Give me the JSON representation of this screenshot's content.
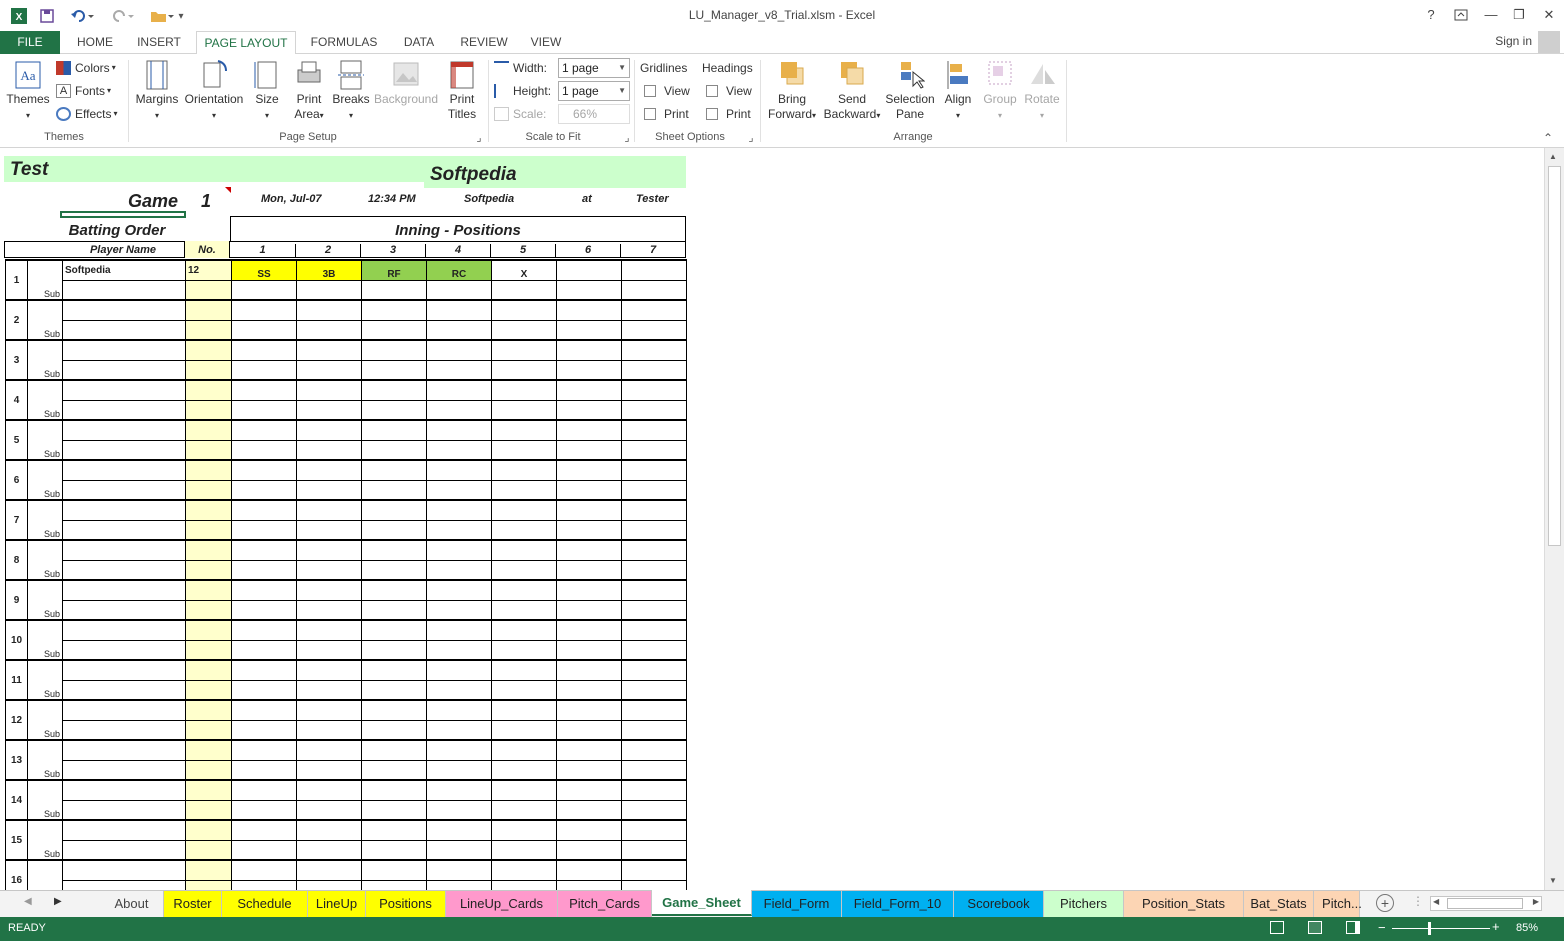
{
  "window": {
    "title": "LU_Manager_v8_Trial.xlsm - Excel",
    "sign_in": "Sign in",
    "help": "?",
    "controls": {
      "minimize": "—",
      "restore": "❐",
      "close": "✕"
    }
  },
  "ribbon_tabs": [
    {
      "label": "FILE"
    },
    {
      "label": "HOME"
    },
    {
      "label": "INSERT"
    },
    {
      "label": "PAGE LAYOUT"
    },
    {
      "label": "FORMULAS"
    },
    {
      "label": "DATA"
    },
    {
      "label": "REVIEW"
    },
    {
      "label": "VIEW"
    }
  ],
  "ribbon": {
    "themes": {
      "themes": "Themes",
      "colors": "Colors",
      "fonts": "Fonts",
      "effects": "Effects",
      "group": "Themes"
    },
    "page_setup": {
      "margins": "Margins",
      "orientation": "Orientation",
      "size": "Size",
      "print_area_1": "Print",
      "print_area_2": "Area",
      "breaks": "Breaks",
      "background": "Background",
      "print_titles_1": "Print",
      "print_titles_2": "Titles",
      "group": "Page Setup"
    },
    "scale": {
      "width_label": "Width:",
      "width_value": "1 page",
      "height_label": "Height:",
      "height_value": "1 page",
      "scale_label": "Scale:",
      "scale_value": "66%",
      "group": "Scale to Fit"
    },
    "sheet_options": {
      "gridlines": "Gridlines",
      "headings": "Headings",
      "view": "View",
      "print": "Print",
      "group": "Sheet Options"
    },
    "arrange": {
      "bring_1": "Bring",
      "bring_2": "Forward",
      "send_1": "Send",
      "send_2": "Backward",
      "selection_1": "Selection",
      "selection_2": "Pane",
      "align": "Align",
      "group_btn": "Group",
      "rotate": "Rotate",
      "group": "Arrange"
    }
  },
  "sheet": {
    "title": "Test",
    "brand": "Softpedia",
    "game_label": "Game",
    "game_number": "1",
    "date": "Mon,  Jul-07",
    "time": "12:34 PM",
    "opponent": "Softpedia",
    "at": "at",
    "location": "Tester",
    "batting_order": "Batting Order",
    "innings_title": "Inning - Positions",
    "col_player": "Player Name",
    "col_no": "No.",
    "innings": [
      "1",
      "2",
      "3",
      "4",
      "5",
      "6",
      "7"
    ],
    "sub_label": "Sub",
    "first_player": {
      "name": "Softpedia",
      "no": "12",
      "positions": [
        "SS",
        "3B",
        "RF",
        "RC",
        "X",
        "",
        ""
      ]
    },
    "order_numbers": [
      "1",
      "2",
      "3",
      "4",
      "5",
      "6",
      "7",
      "8",
      "9",
      "10",
      "11",
      "12",
      "13",
      "14",
      "15",
      "16"
    ]
  },
  "sheet_tabs": [
    {
      "label": "About",
      "color": "#f3f3f3"
    },
    {
      "label": "Roster",
      "color": "#ffff00"
    },
    {
      "label": "Schedule",
      "color": "#ffff00"
    },
    {
      "label": "LineUp",
      "color": "#ffff00"
    },
    {
      "label": "Positions",
      "color": "#ffff00"
    },
    {
      "label": "LineUp_Cards",
      "color": "#ff99cc"
    },
    {
      "label": "Pitch_Cards",
      "color": "#ff99cc"
    },
    {
      "label": "Game_Sheet",
      "color": "#ffffff"
    },
    {
      "label": "Field_Form",
      "color": "#00b0f0"
    },
    {
      "label": "Field_Form_10",
      "color": "#00b0f0"
    },
    {
      "label": "Scorebook",
      "color": "#00b0f0"
    },
    {
      "label": "Pitchers",
      "color": "#ccffcc"
    },
    {
      "label": "Position_Stats",
      "color": "#fcd5b4"
    },
    {
      "label": "Bat_Stats",
      "color": "#fcd5b4"
    },
    {
      "label": "Pitch",
      "color": "#fcd5b4"
    }
  ],
  "status": {
    "ready": "READY",
    "zoom": "85%",
    "ellipsis": "..."
  },
  "colors": {
    "excel_green": "#217346",
    "pos_yellow": "#ffff00",
    "pos_green": "#92d050",
    "header_green": "#ccffcc",
    "no_col": "#ffffcc"
  }
}
